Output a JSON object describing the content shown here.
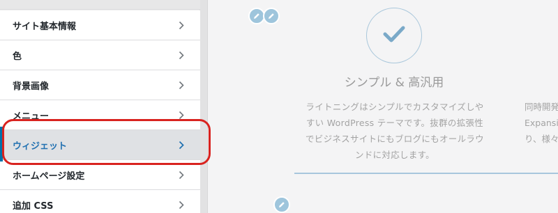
{
  "sidebar": {
    "items": [
      {
        "label": "サイト基本情報"
      },
      {
        "label": "色"
      },
      {
        "label": "背景画像"
      },
      {
        "label": "メニュー"
      },
      {
        "label": "ウィジェット"
      },
      {
        "label": "ホームページ設定"
      },
      {
        "label": "追加 CSS"
      }
    ],
    "active_index": 4
  },
  "preview": {
    "feature_title": "シンプル & 高汎用",
    "feature_lines": [
      "ライトニングはシンプルでカスタマイズしや",
      "すい WordPress テーマです。抜群の拡張性",
      "でビジネスサイトにもブログにもオールラウ",
      "ンドに対応します。"
    ],
    "feature2_lines": [
      "同時開発",
      "Expansi",
      "り、様々"
    ]
  },
  "colors": {
    "accent": "#0073aa",
    "highlight": "#d9231f",
    "shortcut": "#9ec5dc"
  },
  "icons": {
    "chevron": "chevron-right-icon",
    "edit": "pencil-icon",
    "check": "check-icon"
  }
}
